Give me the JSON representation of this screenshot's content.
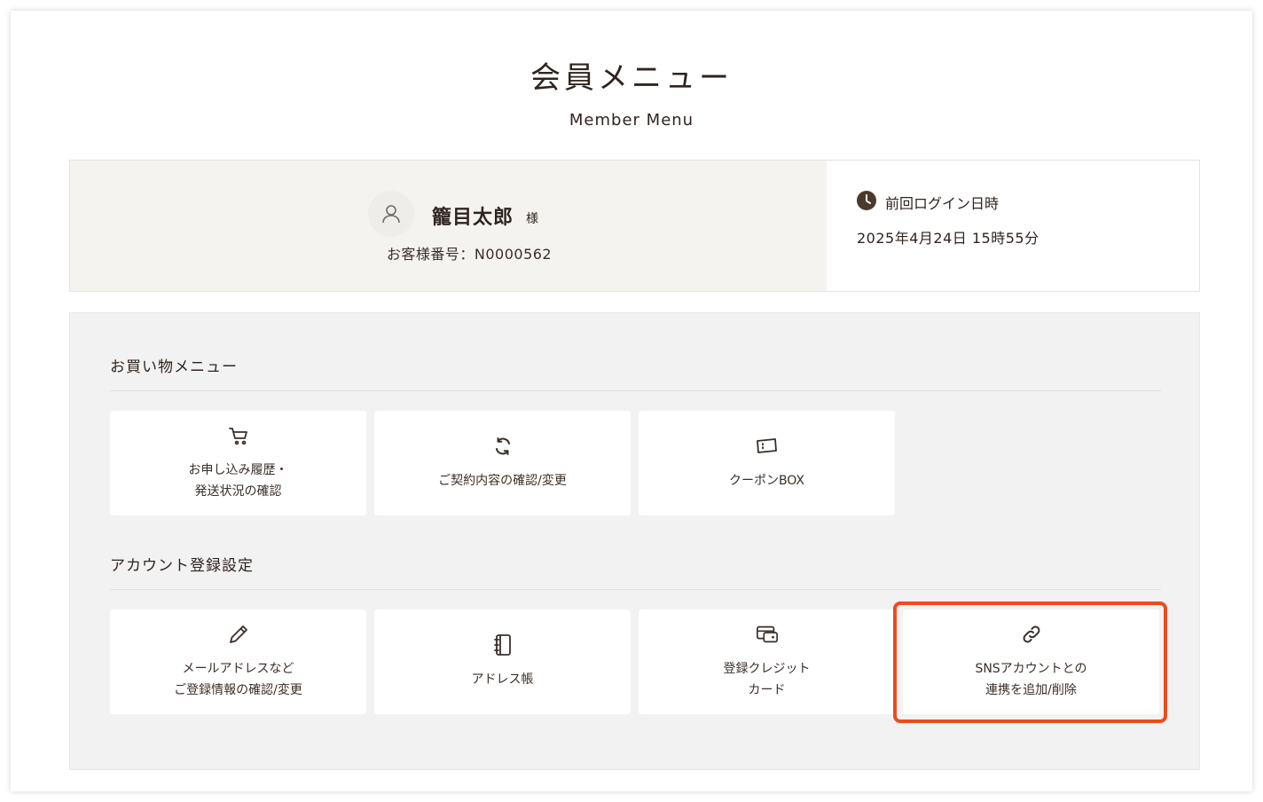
{
  "header": {
    "title": "会員メニュー",
    "subtitle": "Member Menu"
  },
  "member": {
    "name": "籠目太郎",
    "honorific": "様",
    "customer_number": "お客様番号：N0000562",
    "avatar_icon": "user-icon"
  },
  "last_login": {
    "label": "前回ログイン日時",
    "value": "2025年4月24日 15時55分",
    "icon": "clock-icon"
  },
  "shopping_menu": {
    "title": "お買い物メニュー",
    "items": [
      {
        "label": "お申し込み履歴・\n発送状況の確認",
        "icon": "cart-icon"
      },
      {
        "label": "ご契約内容の確認/変更",
        "icon": "refresh-icon"
      },
      {
        "label": "クーポンBOX",
        "icon": "ticket-icon"
      }
    ]
  },
  "account_menu": {
    "title": "アカウント登録設定",
    "items": [
      {
        "label": "メールアドレスなど\nご登録情報の確認/変更",
        "icon": "pencil-icon"
      },
      {
        "label": "アドレス帳",
        "icon": "notebook-icon"
      },
      {
        "label": "登録クレジット\nカード",
        "icon": "credit-card-icon"
      },
      {
        "label": "SNSアカウントとの\n連携を追加/削除",
        "icon": "link-icon"
      }
    ]
  },
  "colors": {
    "text": "#2f241f",
    "panel_bg": "#f2f2f2",
    "member_bg": "#f5f3f0",
    "highlight": "#f04a1d",
    "icon": "#5a4030"
  }
}
